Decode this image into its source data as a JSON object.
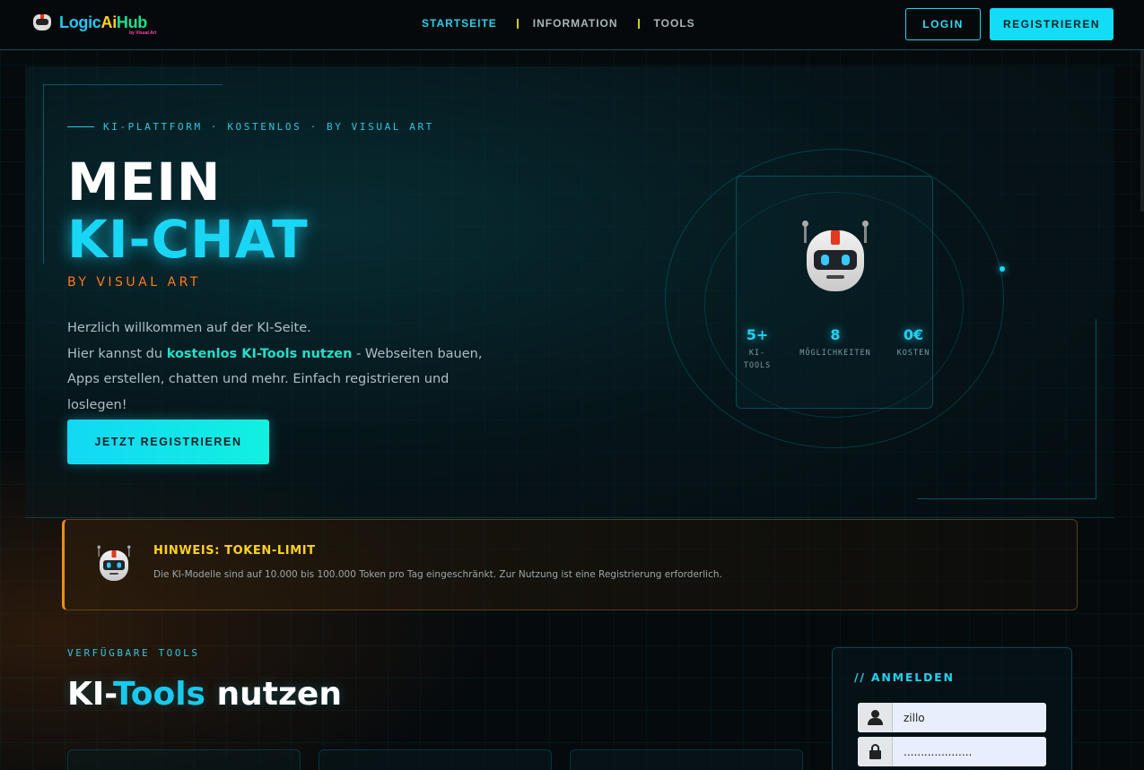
{
  "nav": {
    "logo": {
      "part1": "Logic",
      "part2": "Ai",
      "part3": "Hub",
      "sub": "by Visual Art"
    },
    "links": [
      {
        "label": "STARTSEITE",
        "active": true
      },
      {
        "label": "INFORMATION",
        "active": false
      },
      {
        "label": "TOOLS",
        "active": false
      }
    ],
    "login_label": "LOGIN",
    "register_label": "REGISTRIEREN"
  },
  "hero": {
    "eyebrow": "KI-PLATTFORM · KOSTENLOS · BY VISUAL ART",
    "title_line1": "MEIN",
    "title_line2": "KI-CHAT",
    "byline": "BY VISUAL ART",
    "intro_line1": "Herzlich willkommen auf der KI-Seite.",
    "intro_pre": "Hier kannst du ",
    "intro_strong": "kostenlos KI-Tools nutzen",
    "intro_post": " - Webseiten bauen, Apps erstellen, chatten und mehr. Einfach registrieren und loslegen!",
    "cta_label": "JETZT REGISTRIEREN",
    "stats": [
      {
        "num": "5+",
        "label": "KI-\nTOOLS"
      },
      {
        "num": "8",
        "label": "MÖGLICHKEITEN"
      },
      {
        "num": "0€",
        "label": "KOSTEN"
      }
    ]
  },
  "notice": {
    "title": "HINWEIS: TOKEN-LIMIT",
    "text": "Die KI-Modelle sind auf 10.000 bis 100.000 Token pro Tag eingeschränkt. Zur Nutzung ist eine Registrierung erforderlich."
  },
  "tools": {
    "eyebrow": "VERFÜGBARE TOOLS",
    "title_pre": "KI-",
    "title_accent": "Tools",
    "title_post": " nutzen"
  },
  "login": {
    "title": "// ANMELDEN",
    "username_value": "zillo",
    "password_value": "...................."
  },
  "colors": {
    "accent": "#19d6f5",
    "orange": "#ff7a1a",
    "notice_title": "#ffd21a"
  }
}
